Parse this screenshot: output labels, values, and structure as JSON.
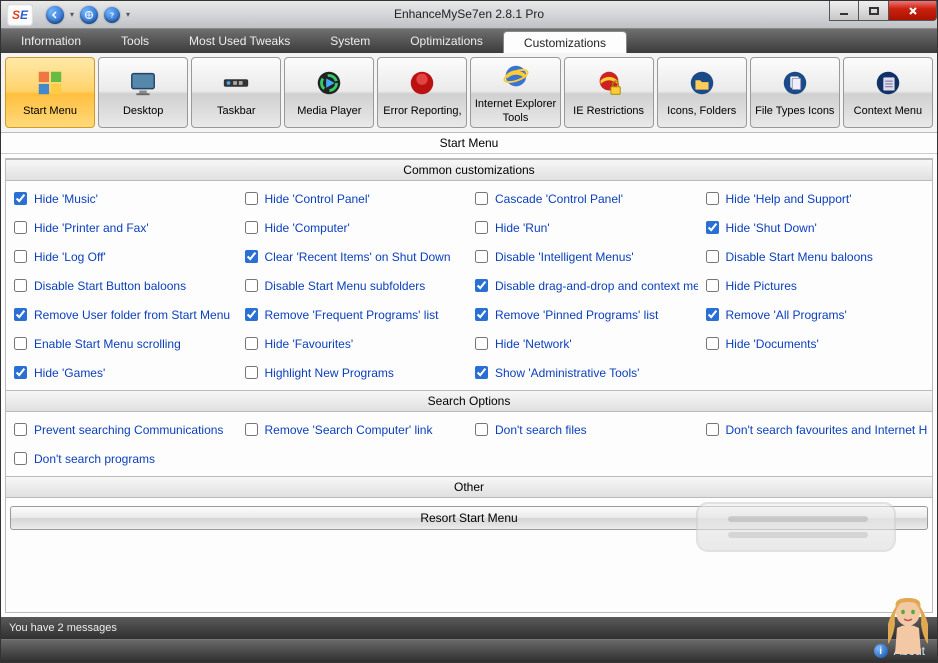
{
  "window": {
    "title": "EnhanceMySe7en 2.8.1 Pro"
  },
  "menu": {
    "tabs": [
      {
        "label": "Information",
        "active": false
      },
      {
        "label": "Tools",
        "active": false
      },
      {
        "label": "Most Used Tweaks",
        "active": false
      },
      {
        "label": "System",
        "active": false
      },
      {
        "label": "Optimizations",
        "active": false
      },
      {
        "label": "Customizations",
        "active": true
      }
    ]
  },
  "toolbar": [
    {
      "label": "Start Menu",
      "icon": "windows-logo",
      "active": true
    },
    {
      "label": "Desktop",
      "icon": "monitor",
      "active": false
    },
    {
      "label": "Taskbar",
      "icon": "taskbar",
      "active": false
    },
    {
      "label": "Media Player",
      "icon": "media",
      "active": false
    },
    {
      "label": "Error Reporting,",
      "icon": "error",
      "active": false
    },
    {
      "label": "Internet Explorer Tools",
      "icon": "ie",
      "active": false
    },
    {
      "label": "IE Restrictions",
      "icon": "ie-lock",
      "active": false
    },
    {
      "label": "Icons,  Folders",
      "icon": "folder",
      "active": false
    },
    {
      "label": "File Types Icons",
      "icon": "files",
      "active": false
    },
    {
      "label": "Context Menu",
      "icon": "context",
      "active": false
    }
  ],
  "sections": {
    "page_title": "Start Menu",
    "common": {
      "title": "Common customizations",
      "items": [
        {
          "label": "Hide 'Music'",
          "checked": true
        },
        {
          "label": "Hide 'Control Panel'",
          "checked": false
        },
        {
          "label": "Cascade 'Control Panel'",
          "checked": false
        },
        {
          "label": "Hide 'Help and Support'",
          "checked": false
        },
        {
          "label": "Hide 'Printer and Fax'",
          "checked": false
        },
        {
          "label": "Hide 'Computer'",
          "checked": false
        },
        {
          "label": "Hide 'Run'",
          "checked": false
        },
        {
          "label": "Hide 'Shut Down'",
          "checked": true
        },
        {
          "label": "Hide 'Log Off'",
          "checked": false
        },
        {
          "label": "Clear 'Recent Items' on Shut Down",
          "checked": true
        },
        {
          "label": "Disable 'Intelligent Menus'",
          "checked": false
        },
        {
          "label": "Disable Start Menu baloons",
          "checked": false
        },
        {
          "label": "Disable Start Button baloons",
          "checked": false
        },
        {
          "label": "Disable Start Menu subfolders",
          "checked": false
        },
        {
          "label": "Disable drag-and-drop and context menu",
          "checked": true
        },
        {
          "label": "Hide Pictures",
          "checked": false
        },
        {
          "label": "Remove User folder from Start Menu",
          "checked": true
        },
        {
          "label": "Remove 'Frequent Programs' list",
          "checked": true
        },
        {
          "label": "Remove 'Pinned Programs' list",
          "checked": true
        },
        {
          "label": "Remove 'All Programs'",
          "checked": true
        },
        {
          "label": "Enable Start Menu scrolling",
          "checked": false
        },
        {
          "label": "Hide 'Favourites'",
          "checked": false
        },
        {
          "label": "Hide 'Network'",
          "checked": false
        },
        {
          "label": "Hide 'Documents'",
          "checked": false
        },
        {
          "label": "Hide 'Games'",
          "checked": true
        },
        {
          "label": "Highlight New Programs",
          "checked": false
        },
        {
          "label": "Show 'Administrative Tools'",
          "checked": true
        }
      ]
    },
    "search": {
      "title": "Search Options",
      "items": [
        {
          "label": "Prevent searching Communications",
          "checked": false
        },
        {
          "label": "Remove 'Search Computer' link",
          "checked": false
        },
        {
          "label": "Don't search files",
          "checked": false
        },
        {
          "label": "Don't search favourites and Internet History",
          "checked": false
        },
        {
          "label": "Don't search programs",
          "checked": false
        }
      ]
    },
    "other": {
      "title": "Other",
      "resort_label": "Resort Start Menu"
    }
  },
  "status": {
    "messages": "You have 2 messages"
  },
  "footer": {
    "about": "About"
  }
}
